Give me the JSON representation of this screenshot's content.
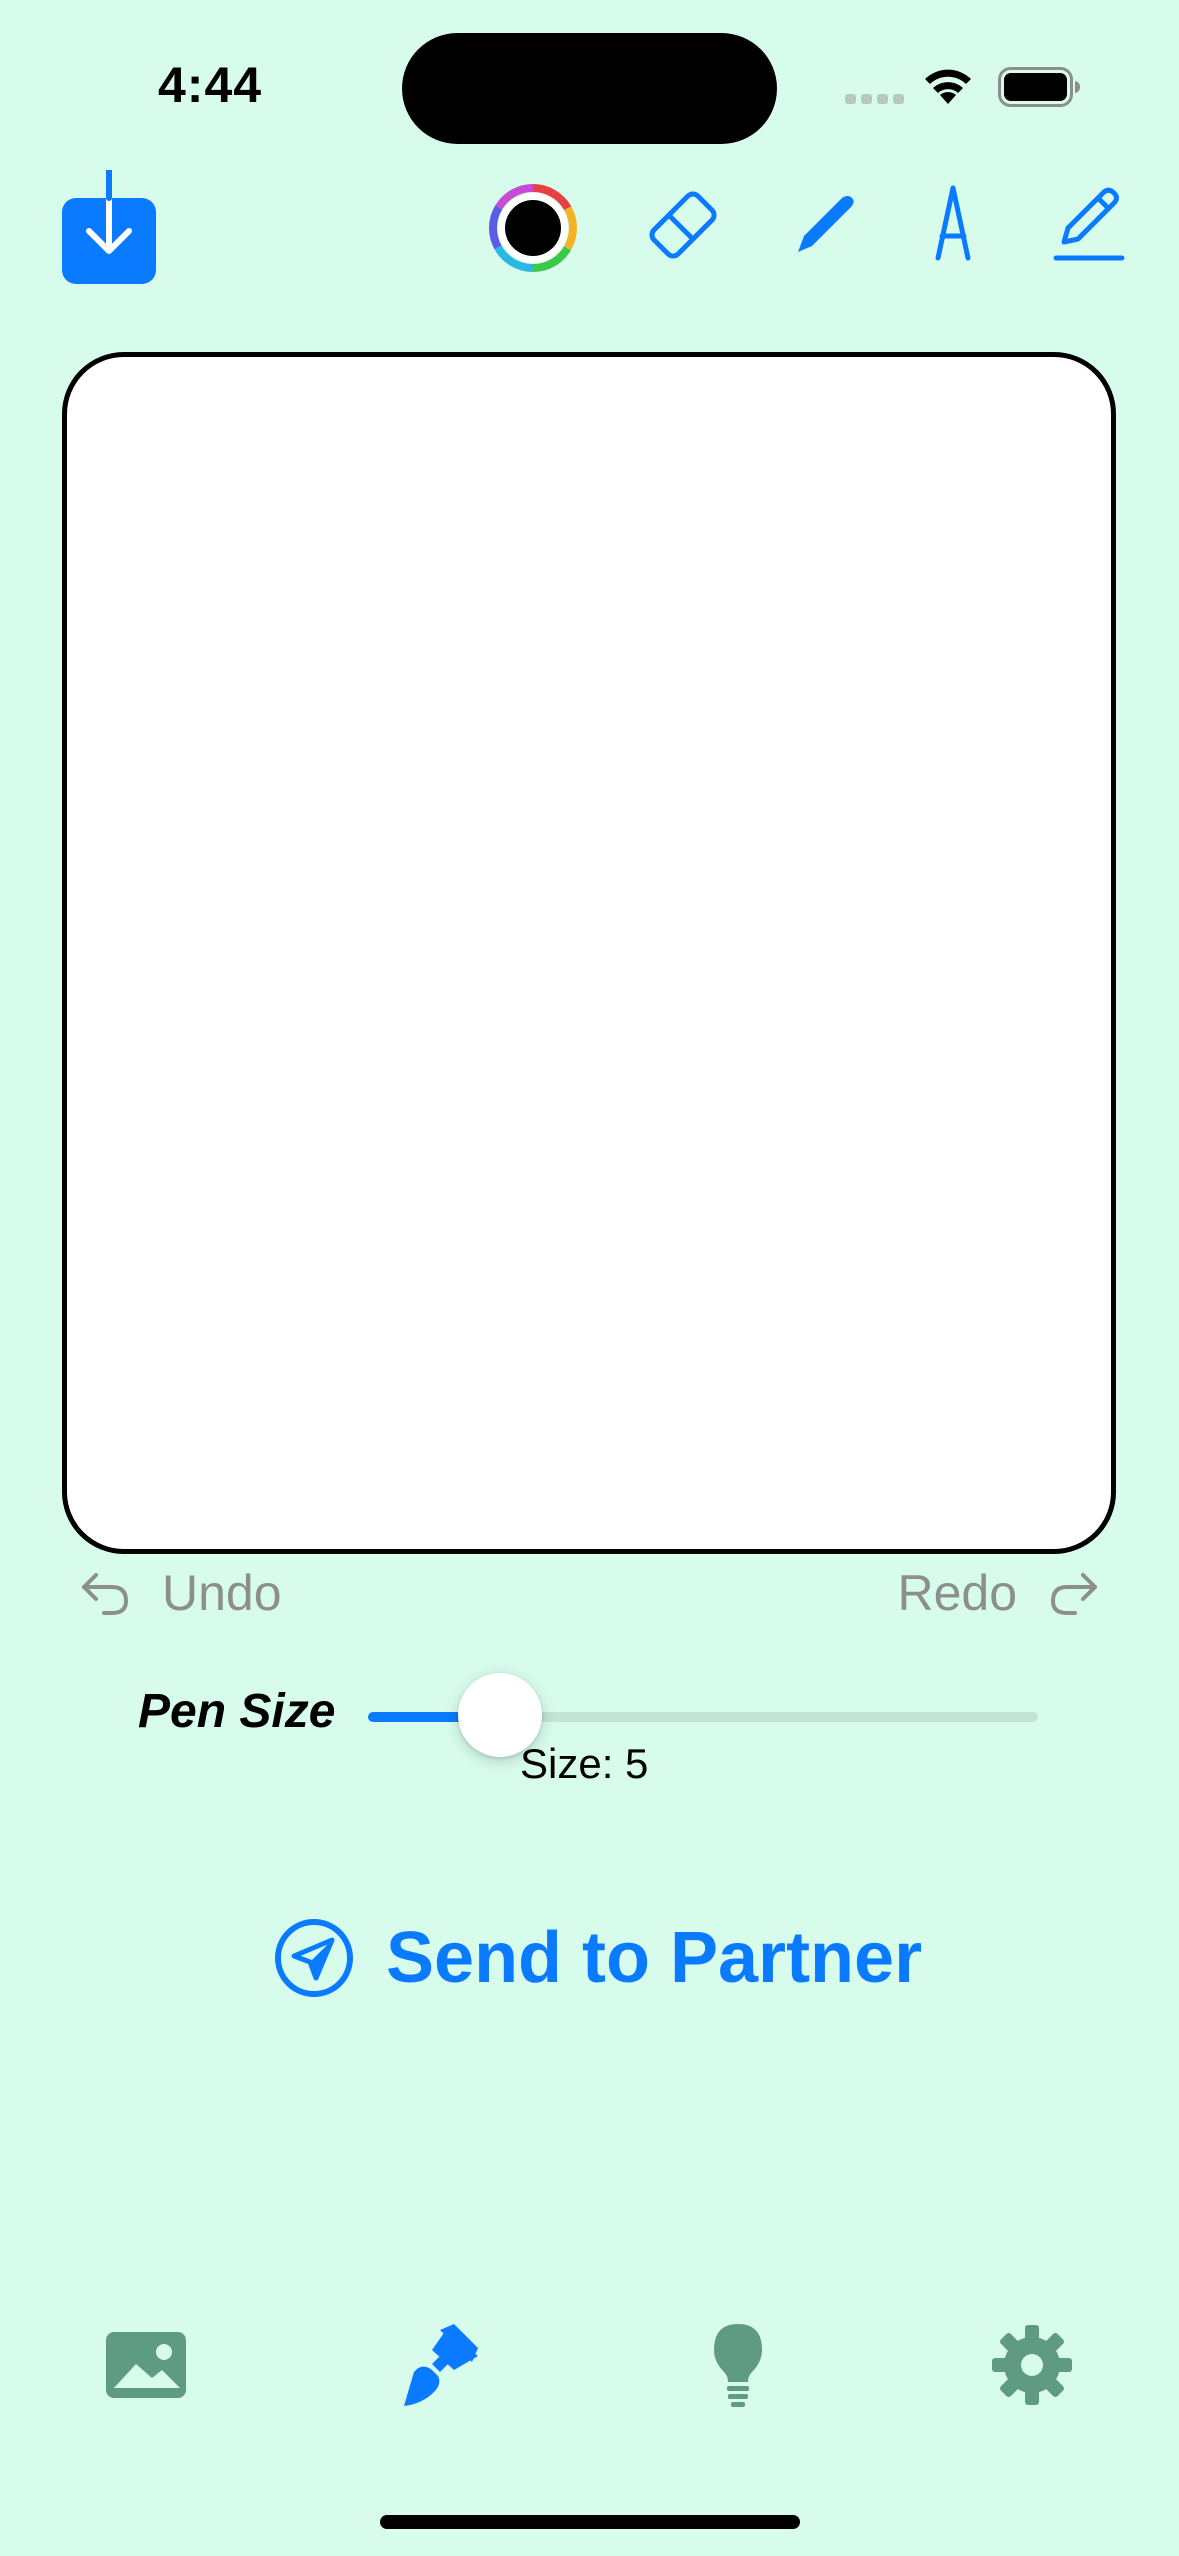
{
  "status_bar": {
    "time": "4:44",
    "icons": [
      "cellular-signal-icon",
      "wifi-icon",
      "battery-icon"
    ]
  },
  "toolbar": {
    "save_icon": "download-icon",
    "color_picker": {
      "selected_color": "#000000"
    },
    "tools": [
      {
        "name": "eraser",
        "icon": "eraser-icon"
      },
      {
        "name": "pen",
        "icon": "pen-icon"
      },
      {
        "name": "fountain-pen",
        "icon": "fountain-pen-icon"
      },
      {
        "name": "pencil-underline",
        "icon": "pencil-underline-icon"
      }
    ]
  },
  "canvas": {
    "background": "#ffffff"
  },
  "history": {
    "undo_label": "Undo",
    "redo_label": "Redo"
  },
  "pen_size": {
    "label": "Pen Size",
    "value": 5,
    "readout": "Size: 5"
  },
  "send": {
    "label": "Send to Partner",
    "icon": "paper-plane-circle-icon"
  },
  "tab_bar": {
    "tabs": [
      {
        "name": "gallery",
        "icon": "photo-icon",
        "selected": false
      },
      {
        "name": "draw",
        "icon": "paintbrush-icon",
        "selected": true
      },
      {
        "name": "ideas",
        "icon": "lightbulb-icon",
        "selected": false
      },
      {
        "name": "settings",
        "icon": "gear-icon",
        "selected": false
      }
    ]
  },
  "colors": {
    "background": "#d8fcec",
    "accent": "#0a7bff",
    "inactive_tab": "#5f9b82",
    "muted_text": "#8b8f8d"
  }
}
